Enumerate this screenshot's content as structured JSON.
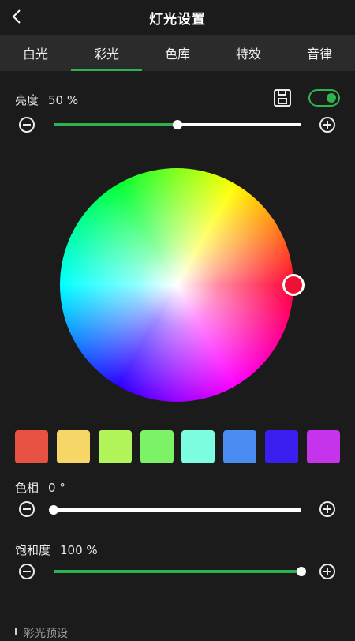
{
  "header": {
    "title": "灯光设置",
    "back_icon": "chevron-left-icon"
  },
  "tabs": [
    {
      "label": "白光",
      "active": false
    },
    {
      "label": "彩光",
      "active": true
    },
    {
      "label": "色库",
      "active": false
    },
    {
      "label": "特效",
      "active": false
    },
    {
      "label": "音律",
      "active": false
    }
  ],
  "brightness": {
    "label": "亮度",
    "value_text": "50 %",
    "value": 50,
    "save_icon": "save-icon",
    "switch_on": true
  },
  "hue": {
    "label": "色相",
    "value_text": "0 °",
    "value": 0
  },
  "saturation": {
    "label": "饱和度",
    "value_text": "100 %",
    "value": 100
  },
  "wheel": {
    "selected_color": "#ee1133"
  },
  "swatches": [
    "#e85243",
    "#f6d667",
    "#b2f55b",
    "#7cf267",
    "#7dfde0",
    "#4b8cf2",
    "#3b1ef0",
    "#c534ec"
  ],
  "colors": {
    "accent": "#2fb24f",
    "background": "#1b1b1b",
    "tab_bar": "#2b2b2b"
  },
  "bottom": {
    "label": "彩光预设"
  }
}
